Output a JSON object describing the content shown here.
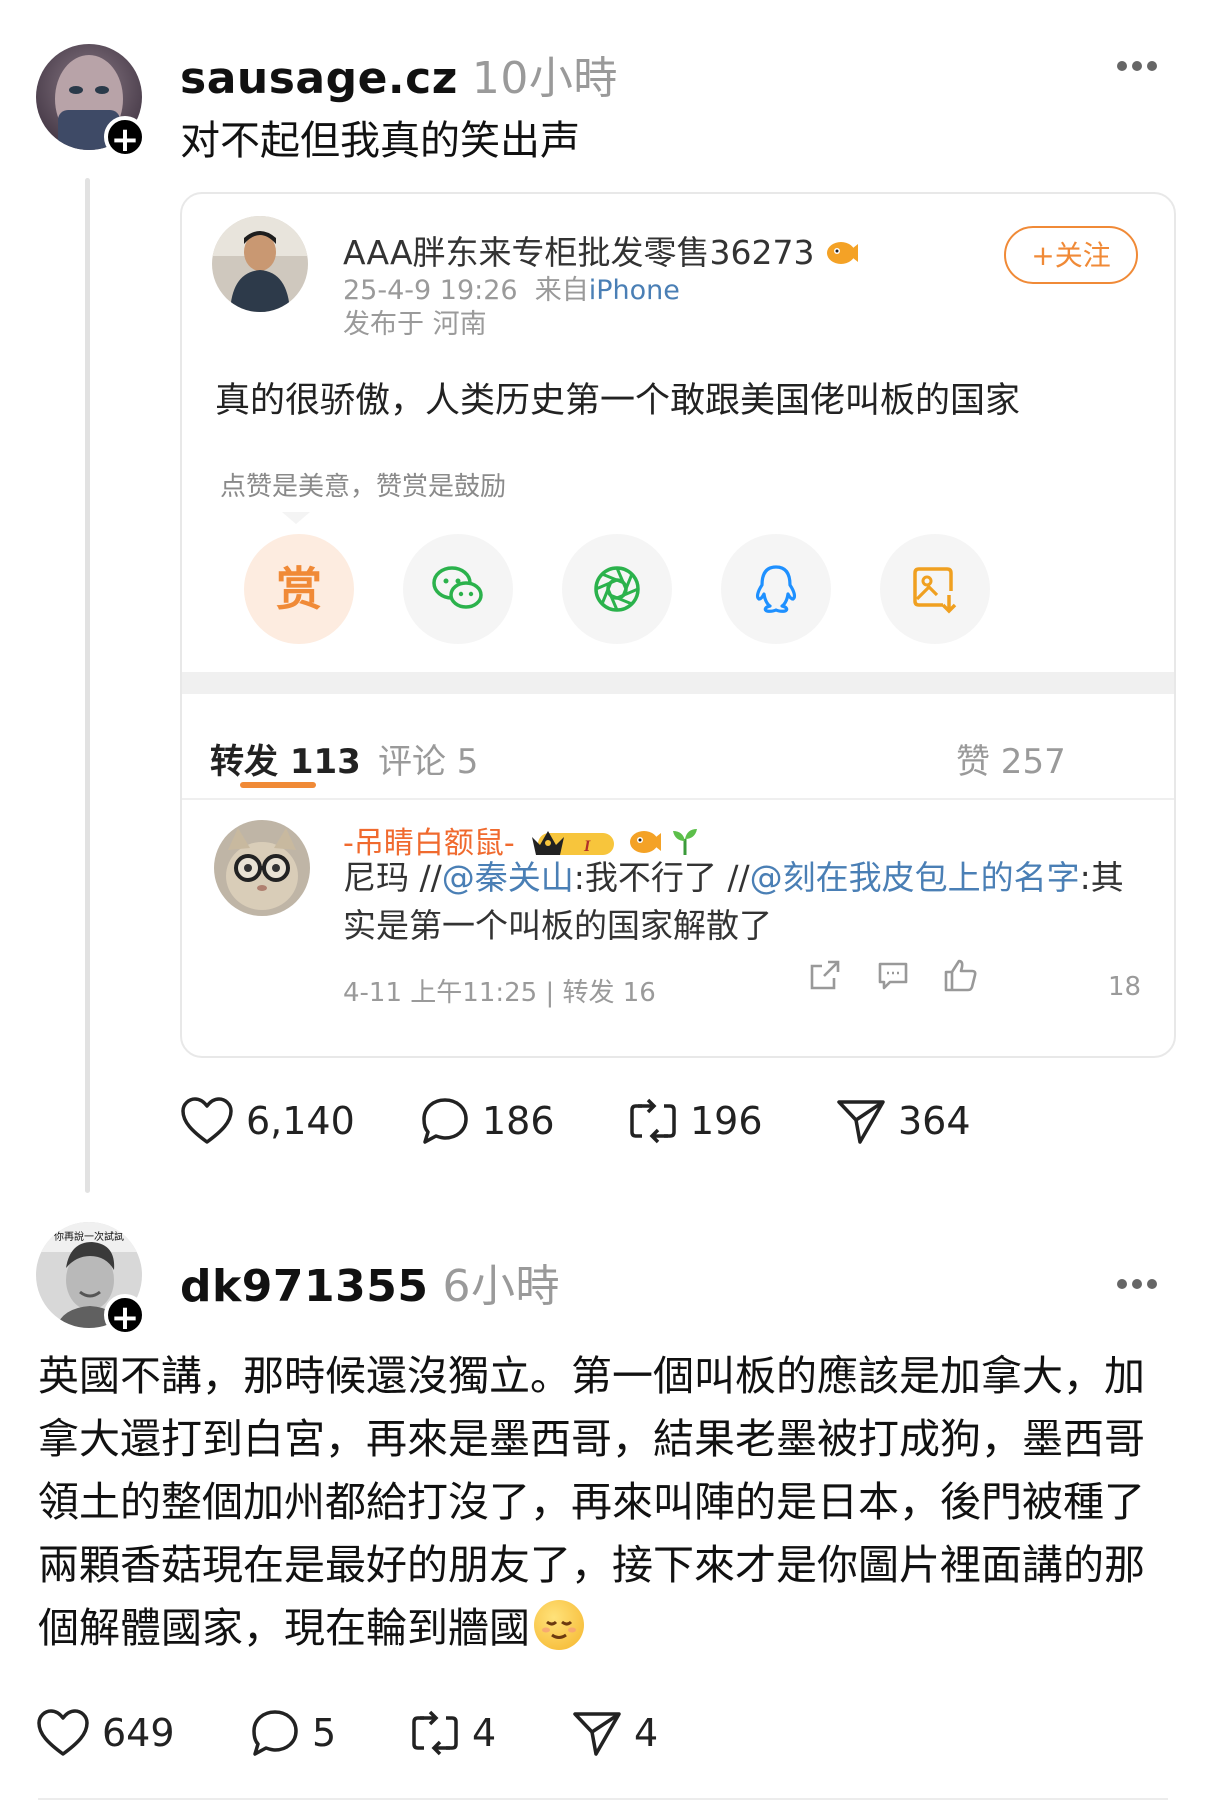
{
  "post1": {
    "username": "sausage.cz",
    "time": "10小時",
    "text": "对不起但我真的笑出声",
    "more_icon": "more-dots-icon",
    "card": {
      "author": "AAA胖东来专柜批发零售36273",
      "timestamp": "25-4-9 19:26",
      "source_prefix": "来自",
      "source": "iPhone",
      "location": "发布于 河南",
      "follow_label": "+关注",
      "content": "真的很骄傲，人类历史第一个敢跟美国佬叫板的国家",
      "reward_tip": "点赞是美意，赞赏是鼓励",
      "reward_label": "赏",
      "share_icons": [
        "reward-icon",
        "wechat-icon",
        "moments-icon",
        "qq-icon",
        "save-image-icon"
      ],
      "tabs": {
        "repost": "转发 113",
        "comment": "评论 5",
        "like": "赞 257"
      },
      "comment": {
        "author": "-吊睛白额鼠-",
        "text_a": "尼玛 //",
        "mention1": "@秦关山",
        "text_b": ":我不行了 //",
        "mention2": "@刻在我皮包上的名字",
        "text_c": ":其实是第一个叫板的国家解散了",
        "meta": "4-11 上午11:25 | 转发 16",
        "like_count": "18"
      }
    },
    "stats": {
      "likes": "6,140",
      "comments": "186",
      "reposts": "196",
      "shares": "364"
    }
  },
  "post2": {
    "username": "dk971355",
    "time": "6小時",
    "avatar_caption": "你再說一次試試",
    "text": "英國不講，那時候還沒獨立。第一個叫板的應該是加拿大，加拿大還打到白宮，再來是墨西哥，結果老墨被打成狗，墨西哥領土的整個加州都給打沒了，再來叫陣的是日本，後門被種了兩顆香菇現在是最好的朋友了，接下來才是你圖片裡面講的那個解體國家，現在輪到牆國",
    "stats": {
      "likes": "649",
      "comments": "5",
      "reposts": "4",
      "shares": "4"
    }
  },
  "colors": {
    "accent": "#f08a37",
    "link": "#4a7fb5",
    "muted": "#9a9a9a"
  }
}
